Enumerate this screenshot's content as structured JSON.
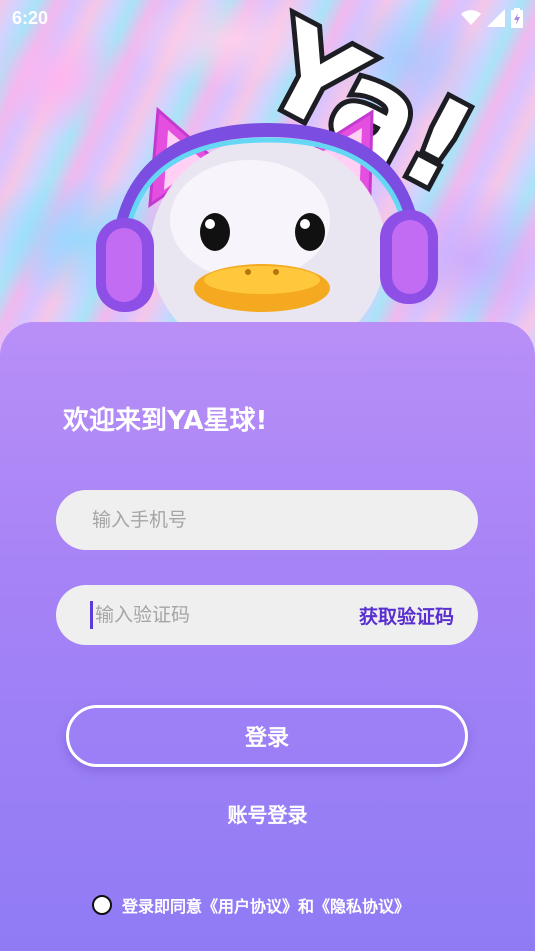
{
  "status_bar": {
    "time": "6:20",
    "icons": [
      "wifi-icon",
      "signal-icon",
      "battery-charging-icon"
    ]
  },
  "hero": {
    "logo_text": "Ya!"
  },
  "login": {
    "welcome": "欢迎来到YA星球!",
    "phone_placeholder": "输入手机号",
    "code_placeholder": "输入验证码",
    "get_code_label": "获取验证码",
    "login_button": "登录",
    "account_login": "账号登录"
  },
  "agreement": {
    "prefix": "登录即同意",
    "user_agreement": "《用户协议》",
    "conjunction": "和",
    "privacy_agreement": "《隐私协议》",
    "checked": false
  },
  "colors": {
    "accent": "#5a2fcf",
    "card_top": "#b98ff7",
    "card_bottom": "#907bf5",
    "field_bg": "#efefef"
  }
}
